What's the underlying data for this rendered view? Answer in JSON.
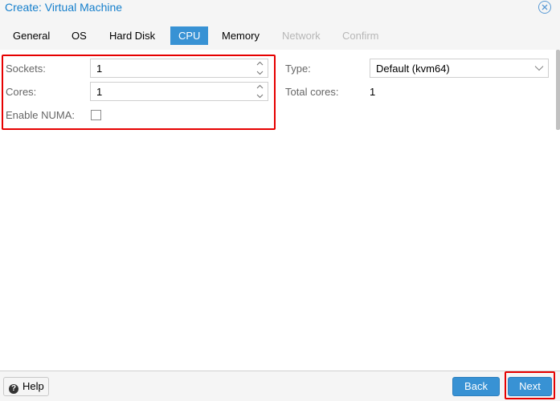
{
  "window": {
    "title": "Create: Virtual Machine"
  },
  "tabs": [
    {
      "label": "General",
      "state": "normal"
    },
    {
      "label": "OS",
      "state": "normal"
    },
    {
      "label": "Hard Disk",
      "state": "normal"
    },
    {
      "label": "CPU",
      "state": "active"
    },
    {
      "label": "Memory",
      "state": "normal"
    },
    {
      "label": "Network",
      "state": "disabled"
    },
    {
      "label": "Confirm",
      "state": "disabled"
    }
  ],
  "form": {
    "sockets": {
      "label": "Sockets:",
      "value": "1"
    },
    "cores": {
      "label": "Cores:",
      "value": "1"
    },
    "numa": {
      "label": "Enable NUMA:",
      "checked": false
    },
    "type": {
      "label": "Type:",
      "value": "Default (kvm64)"
    },
    "total_cores": {
      "label": "Total cores:",
      "value": "1"
    }
  },
  "footer": {
    "help_label": "Help",
    "back_label": "Back",
    "next_label": "Next"
  },
  "colors": {
    "accent": "#3892d4",
    "title": "#157fcc",
    "highlight": "#e60000"
  },
  "icons": {
    "close": "close-icon",
    "help": "help-icon",
    "spinner_up": "chevron-up-icon",
    "spinner_down": "chevron-down-icon",
    "combo": "chevron-down-icon"
  }
}
